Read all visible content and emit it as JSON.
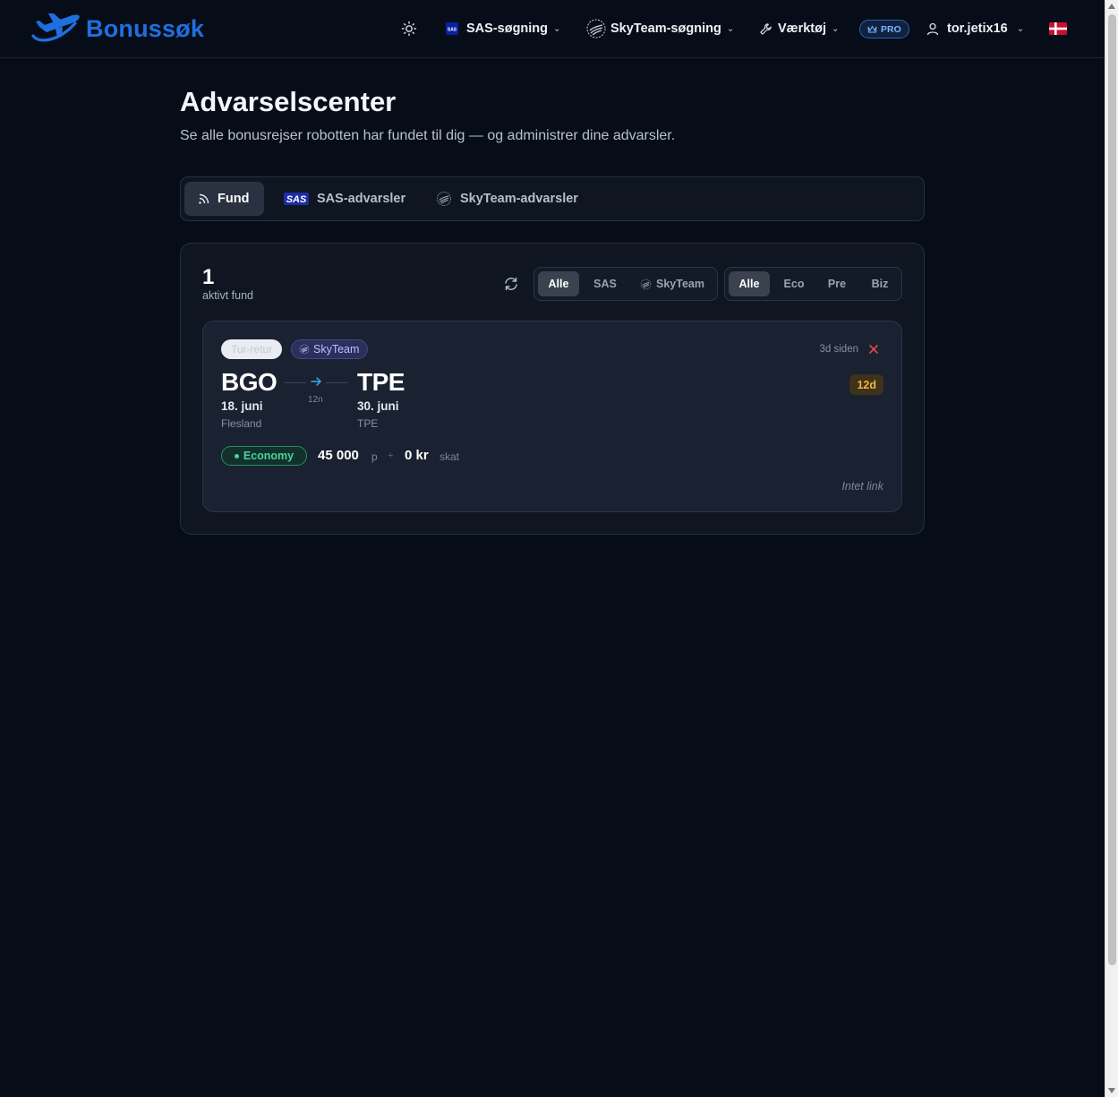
{
  "nav": {
    "brand": "Bonussøk",
    "sas_search": "SAS-søgning",
    "skyteam_search": "SkyTeam-søgning",
    "tools": "Værktøj",
    "pro_badge": "PRO",
    "username": "tor.jetix16"
  },
  "page": {
    "title": "Advarselscenter",
    "subtitle": "Se alle bonusrejser robotten har fundet til dig — og administrer dine advarsler."
  },
  "tabs": [
    {
      "label": "Fund",
      "active": true
    },
    {
      "label": "SAS-advarsler",
      "active": false
    },
    {
      "label": "SkyTeam-advarsler",
      "active": false
    }
  ],
  "summary": {
    "count": "1",
    "label": "aktivt fund"
  },
  "airline_filter": {
    "options": [
      "Alle",
      "SAS",
      "SkyTeam"
    ],
    "selected": "Alle"
  },
  "cabin_filter": {
    "options": [
      "Alle",
      "Eco",
      "Pre",
      "Biz"
    ],
    "selected": "Alle"
  },
  "finding": {
    "trip_type": "Tur-retur",
    "alliance": "SkyTeam",
    "age": "3d siden",
    "origin": {
      "code": "BGO",
      "date": "18. juni",
      "name": "Flesland"
    },
    "destination": {
      "code": "TPE",
      "date": "30. juni",
      "name": "TPE"
    },
    "nights": "12n",
    "days_badge": "12d",
    "cabin": "Economy",
    "points": "45 000",
    "points_unit": "p",
    "plus": "+",
    "tax": "0 kr",
    "tax_label": "skat",
    "link_status": "Intet link"
  },
  "colors": {
    "background": "#070d18",
    "brand": "#1f6fe0",
    "cabin_green": "#49d39c",
    "days_amber": "#f3b33c",
    "close_red": "#e5484d"
  }
}
